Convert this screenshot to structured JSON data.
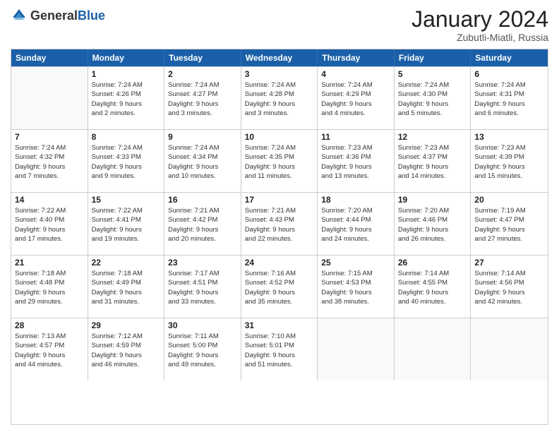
{
  "header": {
    "logo": {
      "general": "General",
      "blue": "Blue"
    },
    "title": "January 2024",
    "location": "Zubutli-Miatli, Russia"
  },
  "weekdays": [
    "Sunday",
    "Monday",
    "Tuesday",
    "Wednesday",
    "Thursday",
    "Friday",
    "Saturday"
  ],
  "weeks": [
    [
      {
        "day": "",
        "info": ""
      },
      {
        "day": "1",
        "info": "Sunrise: 7:24 AM\nSunset: 4:26 PM\nDaylight: 9 hours\nand 2 minutes."
      },
      {
        "day": "2",
        "info": "Sunrise: 7:24 AM\nSunset: 4:27 PM\nDaylight: 9 hours\nand 3 minutes."
      },
      {
        "day": "3",
        "info": "Sunrise: 7:24 AM\nSunset: 4:28 PM\nDaylight: 9 hours\nand 3 minutes."
      },
      {
        "day": "4",
        "info": "Sunrise: 7:24 AM\nSunset: 4:29 PM\nDaylight: 9 hours\nand 4 minutes."
      },
      {
        "day": "5",
        "info": "Sunrise: 7:24 AM\nSunset: 4:30 PM\nDaylight: 9 hours\nand 5 minutes."
      },
      {
        "day": "6",
        "info": "Sunrise: 7:24 AM\nSunset: 4:31 PM\nDaylight: 9 hours\nand 6 minutes."
      }
    ],
    [
      {
        "day": "7",
        "info": "Sunrise: 7:24 AM\nSunset: 4:32 PM\nDaylight: 9 hours\nand 7 minutes."
      },
      {
        "day": "8",
        "info": "Sunrise: 7:24 AM\nSunset: 4:33 PM\nDaylight: 9 hours\nand 9 minutes."
      },
      {
        "day": "9",
        "info": "Sunrise: 7:24 AM\nSunset: 4:34 PM\nDaylight: 9 hours\nand 10 minutes."
      },
      {
        "day": "10",
        "info": "Sunrise: 7:24 AM\nSunset: 4:35 PM\nDaylight: 9 hours\nand 11 minutes."
      },
      {
        "day": "11",
        "info": "Sunrise: 7:23 AM\nSunset: 4:36 PM\nDaylight: 9 hours\nand 13 minutes."
      },
      {
        "day": "12",
        "info": "Sunrise: 7:23 AM\nSunset: 4:37 PM\nDaylight: 9 hours\nand 14 minutes."
      },
      {
        "day": "13",
        "info": "Sunrise: 7:23 AM\nSunset: 4:39 PM\nDaylight: 9 hours\nand 15 minutes."
      }
    ],
    [
      {
        "day": "14",
        "info": "Sunrise: 7:22 AM\nSunset: 4:40 PM\nDaylight: 9 hours\nand 17 minutes."
      },
      {
        "day": "15",
        "info": "Sunrise: 7:22 AM\nSunset: 4:41 PM\nDaylight: 9 hours\nand 19 minutes."
      },
      {
        "day": "16",
        "info": "Sunrise: 7:21 AM\nSunset: 4:42 PM\nDaylight: 9 hours\nand 20 minutes."
      },
      {
        "day": "17",
        "info": "Sunrise: 7:21 AM\nSunset: 4:43 PM\nDaylight: 9 hours\nand 22 minutes."
      },
      {
        "day": "18",
        "info": "Sunrise: 7:20 AM\nSunset: 4:44 PM\nDaylight: 9 hours\nand 24 minutes."
      },
      {
        "day": "19",
        "info": "Sunrise: 7:20 AM\nSunset: 4:46 PM\nDaylight: 9 hours\nand 26 minutes."
      },
      {
        "day": "20",
        "info": "Sunrise: 7:19 AM\nSunset: 4:47 PM\nDaylight: 9 hours\nand 27 minutes."
      }
    ],
    [
      {
        "day": "21",
        "info": "Sunrise: 7:18 AM\nSunset: 4:48 PM\nDaylight: 9 hours\nand 29 minutes."
      },
      {
        "day": "22",
        "info": "Sunrise: 7:18 AM\nSunset: 4:49 PM\nDaylight: 9 hours\nand 31 minutes."
      },
      {
        "day": "23",
        "info": "Sunrise: 7:17 AM\nSunset: 4:51 PM\nDaylight: 9 hours\nand 33 minutes."
      },
      {
        "day": "24",
        "info": "Sunrise: 7:16 AM\nSunset: 4:52 PM\nDaylight: 9 hours\nand 35 minutes."
      },
      {
        "day": "25",
        "info": "Sunrise: 7:15 AM\nSunset: 4:53 PM\nDaylight: 9 hours\nand 38 minutes."
      },
      {
        "day": "26",
        "info": "Sunrise: 7:14 AM\nSunset: 4:55 PM\nDaylight: 9 hours\nand 40 minutes."
      },
      {
        "day": "27",
        "info": "Sunrise: 7:14 AM\nSunset: 4:56 PM\nDaylight: 9 hours\nand 42 minutes."
      }
    ],
    [
      {
        "day": "28",
        "info": "Sunrise: 7:13 AM\nSunset: 4:57 PM\nDaylight: 9 hours\nand 44 minutes."
      },
      {
        "day": "29",
        "info": "Sunrise: 7:12 AM\nSunset: 4:59 PM\nDaylight: 9 hours\nand 46 minutes."
      },
      {
        "day": "30",
        "info": "Sunrise: 7:11 AM\nSunset: 5:00 PM\nDaylight: 9 hours\nand 49 minutes."
      },
      {
        "day": "31",
        "info": "Sunrise: 7:10 AM\nSunset: 5:01 PM\nDaylight: 9 hours\nand 51 minutes."
      },
      {
        "day": "",
        "info": ""
      },
      {
        "day": "",
        "info": ""
      },
      {
        "day": "",
        "info": ""
      }
    ]
  ]
}
